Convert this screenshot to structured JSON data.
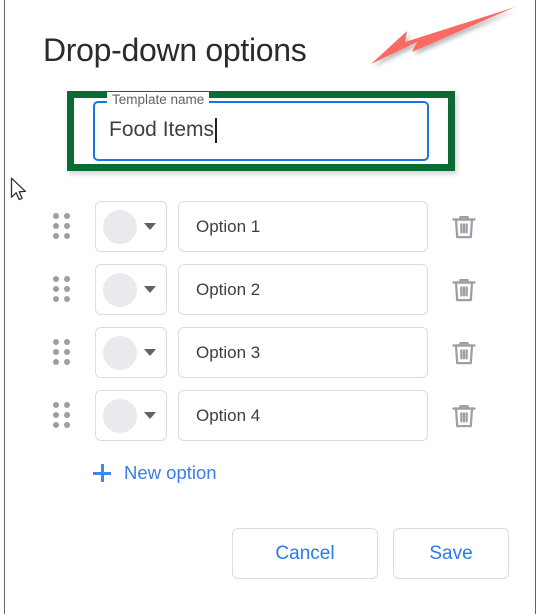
{
  "dialog": {
    "title": "Drop-down options"
  },
  "template_field": {
    "label": "Template name",
    "value": "Food Items",
    "focused": true,
    "highlight_color": "#0c6b35",
    "focus_border_color": "#1a73e8"
  },
  "options": [
    {
      "drag_handle": "drag-handle-icon",
      "color_label": "",
      "text": "Option 1",
      "delete_label": "delete-icon"
    },
    {
      "drag_handle": "drag-handle-icon",
      "color_label": "",
      "text": "Option 2",
      "delete_label": "delete-icon"
    },
    {
      "drag_handle": "drag-handle-icon",
      "color_label": "",
      "text": "Option 3",
      "delete_label": "delete-icon"
    },
    {
      "drag_handle": "drag-handle-icon",
      "color_label": "",
      "text": "Option 4",
      "delete_label": "delete-icon"
    }
  ],
  "new_option": {
    "label": "New option",
    "icon": "plus-icon",
    "color": "#3b7ded"
  },
  "footer": {
    "cancel_label": "Cancel",
    "save_label": "Save",
    "text_color": "#2979f2"
  },
  "annotation": {
    "arrow_color": "#f96a64",
    "arrow_points_to": "template-name-field"
  },
  "colors": {
    "swatch_fill": "#e8eaed",
    "field_border": "#dadce0",
    "icon_gray": "#9aa0a6",
    "title_color": "#2b2b2b"
  }
}
